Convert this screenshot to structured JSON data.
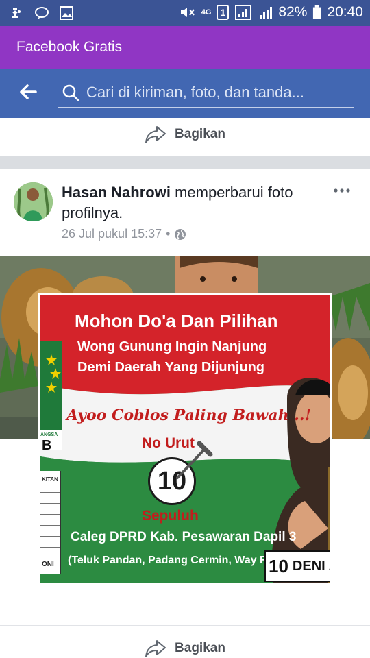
{
  "status_bar": {
    "network": "4G",
    "sim_slot": "1",
    "battery": "82%",
    "time": "20:40"
  },
  "app": {
    "title": "Facebook Gratis"
  },
  "search": {
    "placeholder": "Cari di kiriman, foto, dan tanda..."
  },
  "share_top": {
    "label": "Bagikan"
  },
  "post": {
    "author": "Hasan Nahrowi",
    "action": "memperbarui foto profilnya.",
    "timestamp": "26 Jul pukul 15:37",
    "separator": "•"
  },
  "poster": {
    "line1": "Mohon Do'a Dan Pilihan",
    "line2": "Wong Gunung Ingin Nanjung",
    "line3": "Demi Daerah Yang Dijunjung",
    "ayo": "Ayoo Coblos Paling Bawah ..!",
    "no_urut": "No Urut",
    "number": "10",
    "sepuluh": "Sepuluh",
    "caleg": "Caleg DPRD Kab. Pesawaran Dapil 3",
    "dapil": "(Teluk Pandan, Padang Cermin, Way Ratai)",
    "name_box": "DENI A",
    "ballot_label": "KITAN",
    "ballot_bottom": "ONI",
    "party": "B",
    "party_small": "ANGSA"
  },
  "share_bottom": {
    "label": "Bagikan"
  },
  "colors": {
    "status_bar": "#3b5495",
    "banner": "#9036c4",
    "search_bar": "#4267b2",
    "poster_red": "#d4232a",
    "poster_green": "#2c8b41"
  }
}
